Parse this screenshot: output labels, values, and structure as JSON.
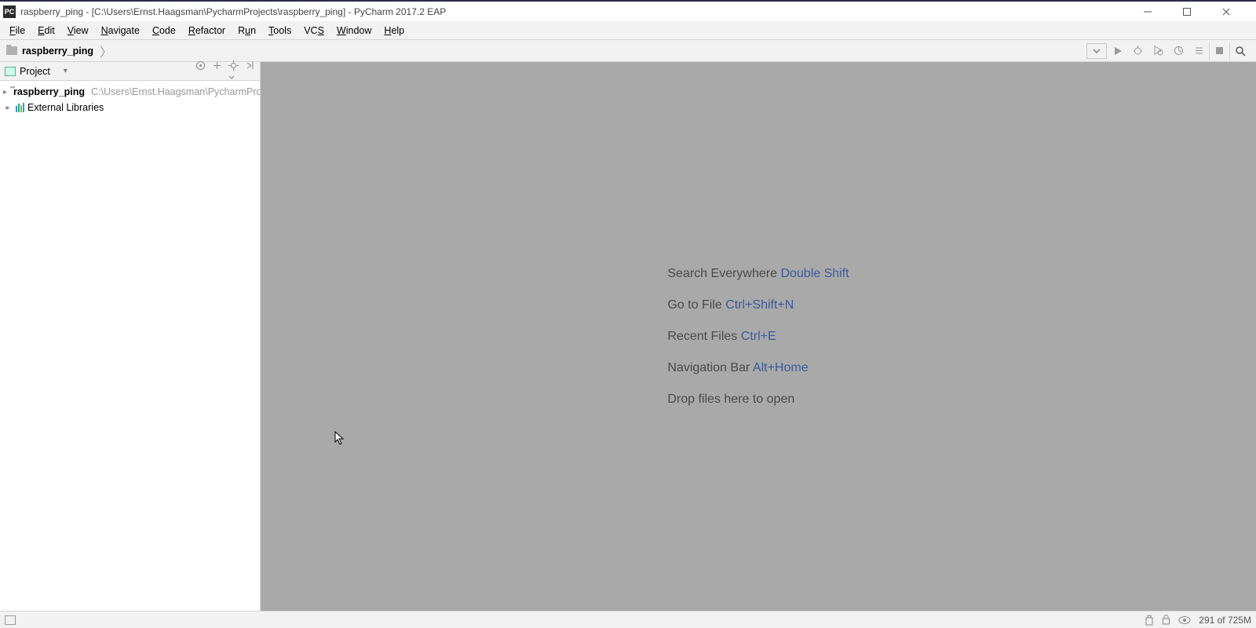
{
  "titlebar": {
    "app_icon_text": "PC",
    "title": "raspberry_ping - [C:\\Users\\Ernst.Haagsman\\PycharmProjects\\raspberry_ping] - PyCharm 2017.2 EAP"
  },
  "menu": {
    "items": [
      {
        "label": "File",
        "accel": "F"
      },
      {
        "label": "Edit",
        "accel": "E"
      },
      {
        "label": "View",
        "accel": "V"
      },
      {
        "label": "Navigate",
        "accel": "N"
      },
      {
        "label": "Code",
        "accel": "C"
      },
      {
        "label": "Refactor",
        "accel": "R"
      },
      {
        "label": "Run",
        "accel": "u"
      },
      {
        "label": "Tools",
        "accel": "T"
      },
      {
        "label": "VCS",
        "accel": "S"
      },
      {
        "label": "Window",
        "accel": "W"
      },
      {
        "label": "Help",
        "accel": "H"
      }
    ]
  },
  "breadcrumb": {
    "root": "raspberry_ping"
  },
  "project_tool": {
    "title": "Project",
    "nodes": {
      "root_name": "raspberry_ping",
      "root_path": "C:\\Users\\Ernst.Haagsman\\PycharmProjects\\raspberry_ping",
      "external": "External Libraries"
    }
  },
  "editor_hints": {
    "search_label": "Search Everywhere",
    "search_shortcut": "Double Shift",
    "goto_label": "Go to File",
    "goto_shortcut": "Ctrl+Shift+N",
    "recent_label": "Recent Files",
    "recent_shortcut": "Ctrl+E",
    "nav_label": "Navigation Bar",
    "nav_shortcut": "Alt+Home",
    "drop_label": "Drop files here to open"
  },
  "statusbar": {
    "memory": "291 of 725M"
  }
}
